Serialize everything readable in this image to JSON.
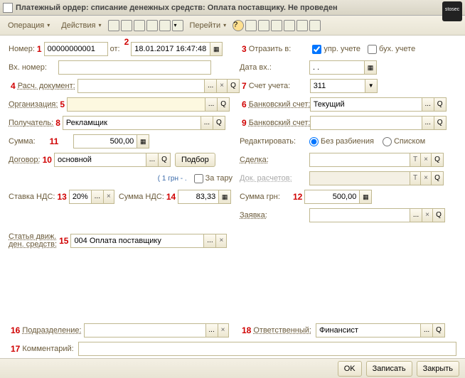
{
  "title": "Платежный ордер: списание денежных средств: Оплата поставщику. Не проведен",
  "logo": "stosec",
  "toolbar": {
    "operation": "Операция",
    "actions": "Действия",
    "goto": "Перейти"
  },
  "markers": {
    "m1": "1",
    "m2": "2",
    "m3": "3",
    "m4": "4",
    "m5": "5",
    "m6": "6",
    "m7": "7",
    "m8": "8",
    "m9": "9",
    "m10": "10",
    "m11": "11",
    "m12": "12",
    "m13": "13",
    "m14": "14",
    "m15": "15",
    "m16": "16",
    "m17": "17",
    "m18": "18"
  },
  "labels": {
    "number": "Номер:",
    "from": "от:",
    "reflect": "Отразить в:",
    "upr": "упр. учете",
    "bux": "бух. учете",
    "inNumber": "Вх. номер:",
    "inDate": "Дата вх.:",
    "raschDoc": "Расч. документ:",
    "account": "Счет учета:",
    "org": "Организация:",
    "bankAcc": "Банковский счет:",
    "recipient": "Получатель:",
    "bankAcc2": "Банковский счет:",
    "sum": "Сумма:",
    "edit": "Редактировать:",
    "noSplit": "Без разбиения",
    "list": "Списком",
    "contract": "Договор:",
    "select": "Подбор",
    "deal": "Сделка:",
    "hint1grn": "( 1 грн - .",
    "zaTaru": "За тару",
    "docRasch": "Док. расчетов:",
    "vatRate": "Ставка НДС:",
    "vatSum": "Сумма НДС:",
    "sumGrn": "Сумма грн:",
    "zayavka": "Заявка:",
    "article": "Статья движ.\nден. средств:",
    "articleL1": "Статья движ.",
    "articleL2": "ден. средств:",
    "subdiv": "Подразделение:",
    "respons": "Ответственный:",
    "comment": "Комментарий:"
  },
  "values": {
    "number": "00000000001",
    "date": "18.01.2017 16:47:48",
    "inDate": ". .",
    "account": "311",
    "bankAcc": "Текущий",
    "recipient": "Рекламщик",
    "sum": "500,00",
    "contract": "основной",
    "vatRate": "20%",
    "vatSum": "83,33",
    "sumGrn": "500,00",
    "article": "004 Оплата поставщику",
    "respons": "Финансист"
  },
  "icons": {
    "dots": "...",
    "x": "×",
    "q": "Q",
    "cal": "▦",
    "dd": "▼",
    "t": "T"
  },
  "footer": {
    "ok": "OK",
    "save": "Записать",
    "close": "Закрыть"
  }
}
